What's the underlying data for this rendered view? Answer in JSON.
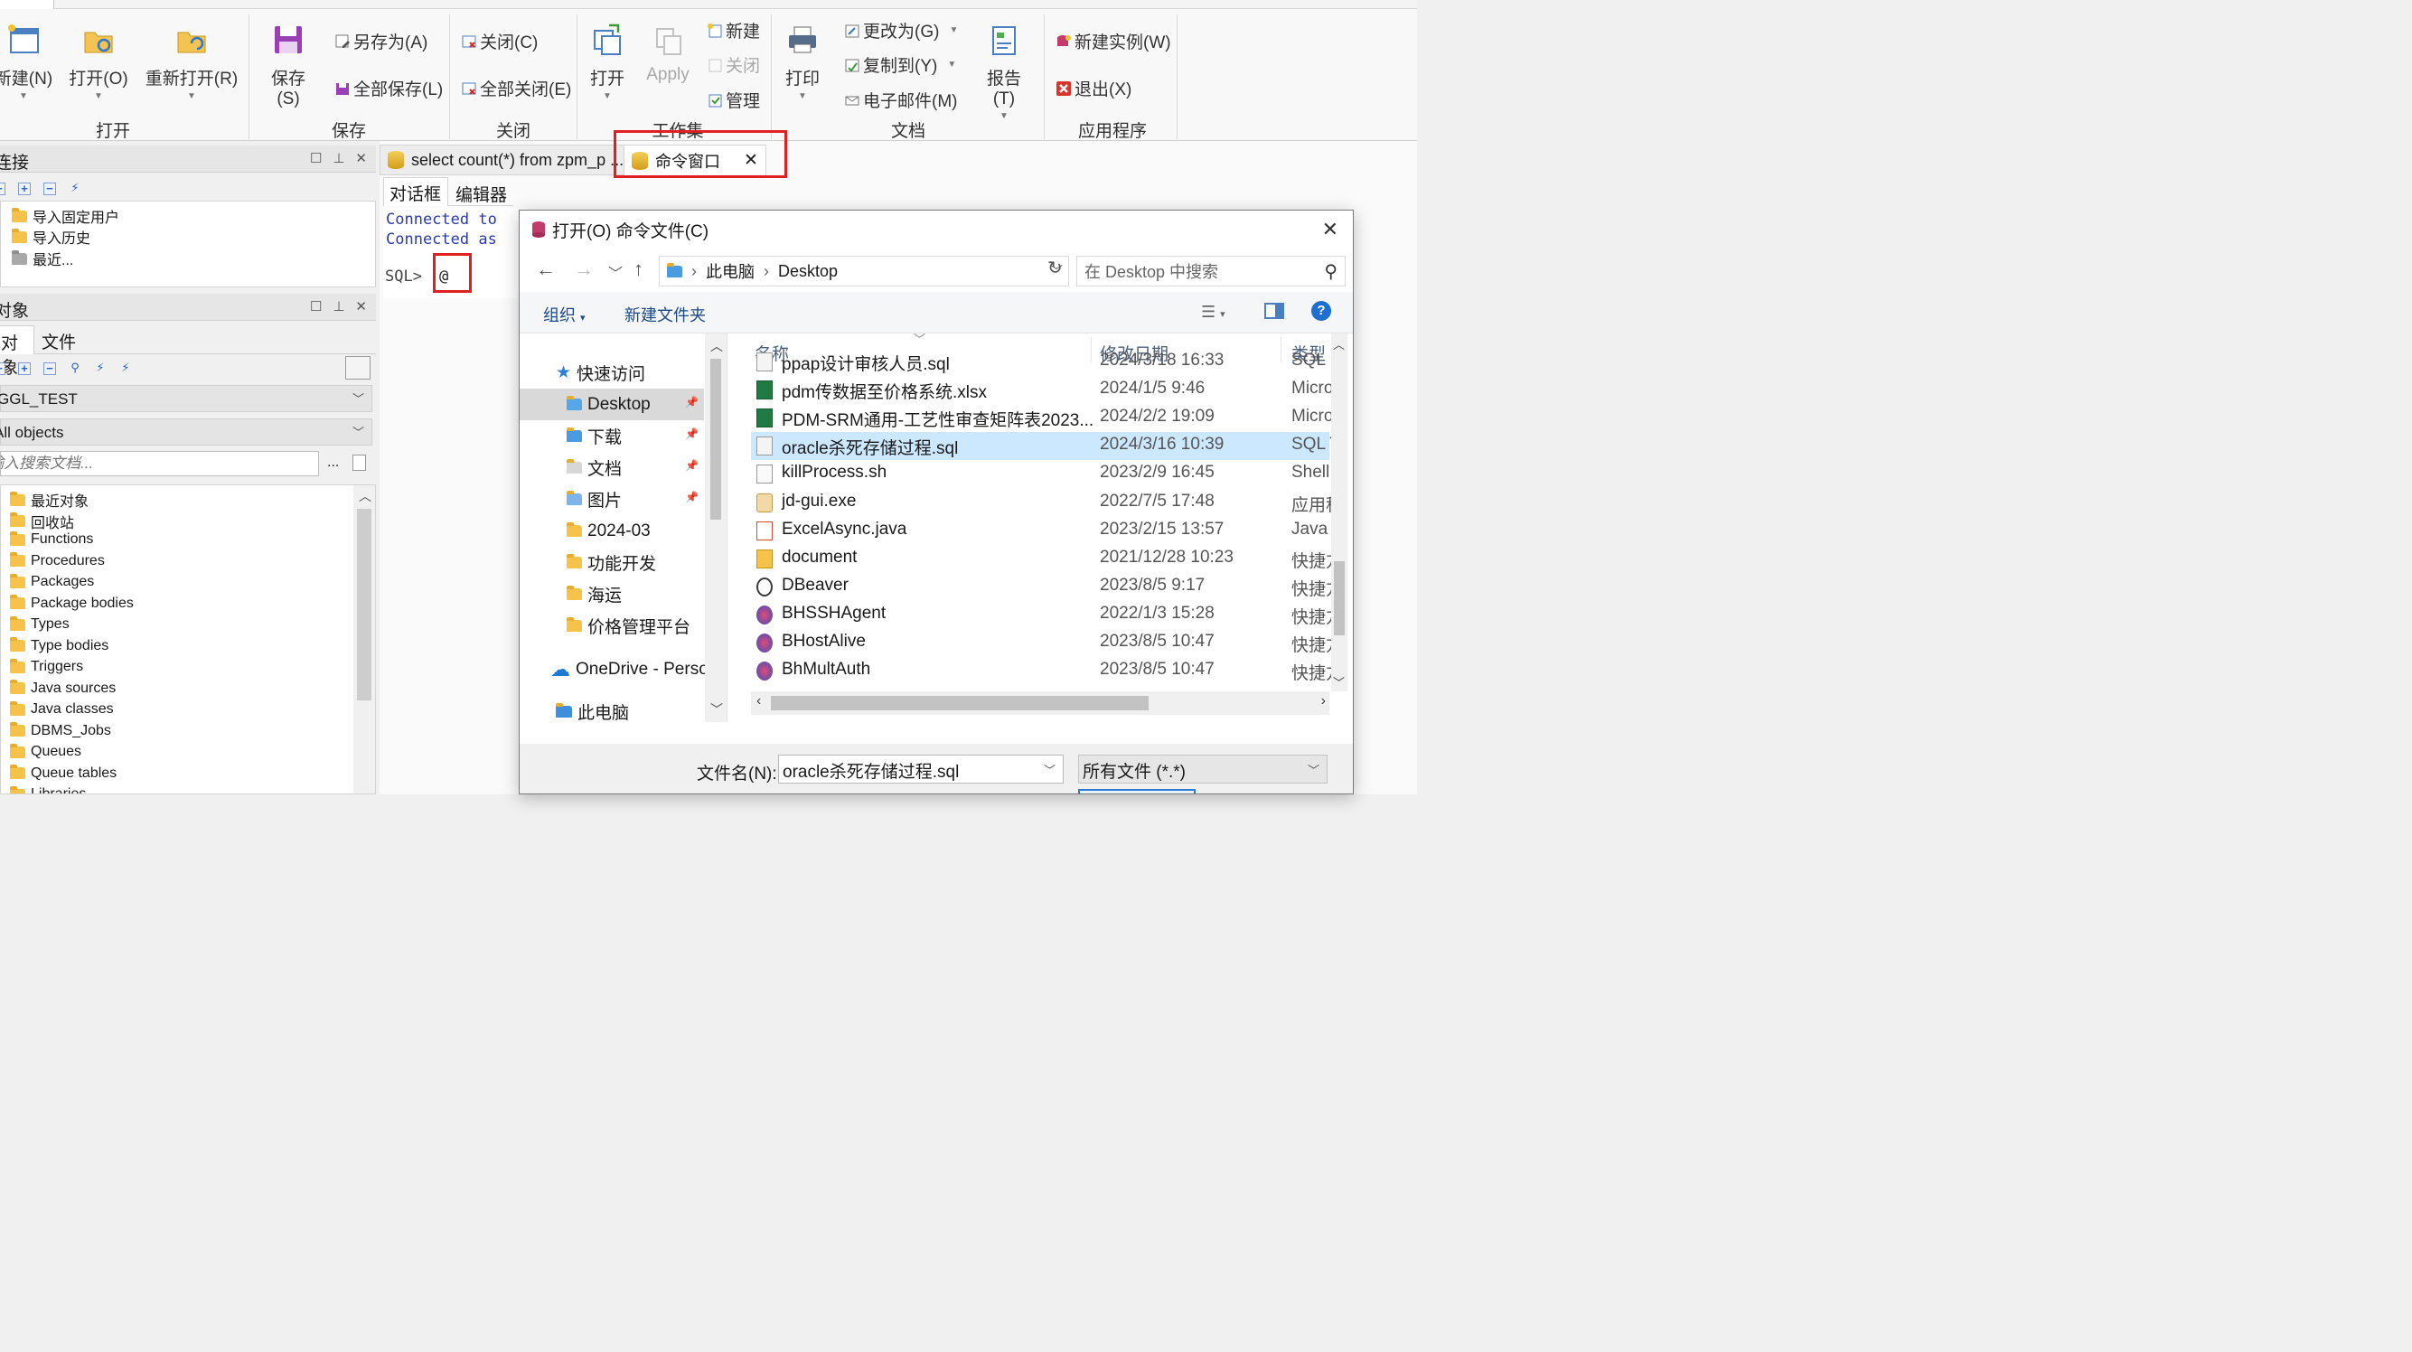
{
  "ribbon": {
    "groups": {
      "open": "打开",
      "save": "保存",
      "close": "关闭",
      "workset": "工作集",
      "document": "文档",
      "application": "应用程序"
    },
    "new_label": "新建(N)",
    "open_label": "打开(O)",
    "reopen_label": "重新打开(R)",
    "save_label": "保存(S)",
    "save_as_label": "另存为(A)",
    "save_all_label": "全部保存(L)",
    "close_label": "关闭(C)",
    "close_all_label": "全部关闭(E)",
    "ws_open_label": "打开",
    "ws_apply_label": "Apply",
    "ws_new_label": "新建",
    "ws_close_label": "关闭",
    "ws_manage_label": "管理",
    "print_label": "打印",
    "change_to_label": "更改为(G)",
    "copy_to_label": "复制到(Y)",
    "email_label": "电子邮件(M)",
    "report_label": "报告(T)",
    "new_instance_label": "新建实例(W)",
    "exit_label": "退出(X)"
  },
  "connection_panel": {
    "title": "连接",
    "items": [
      "导入固定用户",
      "导入历史",
      "最近..."
    ]
  },
  "object_panel": {
    "title": "对象",
    "tabs": [
      "对象",
      "文件"
    ],
    "schema": "GGL_TEST",
    "filter": "All objects",
    "search_placeholder": "输入搜索文档...",
    "tree": [
      "最近对象",
      "回收站",
      "Functions",
      "Procedures",
      "Packages",
      "Package bodies",
      "Types",
      "Type bodies",
      "Triggers",
      "Java sources",
      "Java classes",
      "DBMS_Jobs",
      "Queues",
      "Queue tables",
      "Libraries"
    ]
  },
  "editor": {
    "tabs": [
      "select count(*) from zpm_p ...",
      "命令窗口"
    ],
    "subtabs": [
      "对话框",
      "编辑器"
    ],
    "console_lines": [
      "Connected to",
      "Connected as"
    ],
    "prompt": "SQL>",
    "input": "@"
  },
  "dialog": {
    "title": "打开(O) 命令文件(C)",
    "breadcrumb": [
      "此电脑",
      "Desktop"
    ],
    "search_placeholder": "在 Desktop 中搜索",
    "organize_label": "组织",
    "new_folder_label": "新建文件夹",
    "nav_items": [
      {
        "label": "快速访问"
      },
      {
        "label": "Desktop"
      },
      {
        "label": "下载"
      },
      {
        "label": "文档"
      },
      {
        "label": "图片"
      },
      {
        "label": "2024-03"
      },
      {
        "label": "功能开发"
      },
      {
        "label": "海运"
      },
      {
        "label": "价格管理平台"
      },
      {
        "label": "OneDrive - Perso"
      },
      {
        "label": "此电脑"
      }
    ],
    "columns": {
      "name": "名称",
      "date": "修改日期",
      "type": "类型"
    },
    "files": [
      {
        "name": "ppap设计审核人员.sql",
        "date": "2024/3/18 16:33",
        "type": "SQL",
        "icon": "sql-file-icon"
      },
      {
        "name": "pdm传数据至价格系统.xlsx",
        "date": "2024/1/5 9:46",
        "type": "Micro",
        "icon": "excel-file-icon"
      },
      {
        "name": "PDM-SRM通用-工艺性审查矩阵表2023...",
        "date": "2024/2/2 19:09",
        "type": "Micro",
        "icon": "excel-file-icon"
      },
      {
        "name": "oracle杀死存储过程.sql",
        "date": "2024/3/16 10:39",
        "type": "SQL T",
        "icon": "sql-file-icon",
        "selected": true
      },
      {
        "name": "killProcess.sh",
        "date": "2023/2/9 16:45",
        "type": "Shell",
        "icon": "shell-file-icon"
      },
      {
        "name": "jd-gui.exe",
        "date": "2022/7/5 17:48",
        "type": "应用程",
        "icon": "exe-file-icon"
      },
      {
        "name": "ExcelAsync.java",
        "date": "2023/2/15 13:57",
        "type": "Java",
        "icon": "java-file-icon"
      },
      {
        "name": "document",
        "date": "2021/12/28 10:23",
        "type": "快捷方",
        "icon": "shortcut-folder-icon"
      },
      {
        "name": "DBeaver",
        "date": "2023/8/5 9:17",
        "type": "快捷方",
        "icon": "dbeaver-app-icon"
      },
      {
        "name": "BHSSHAgent",
        "date": "2022/1/3 15:28",
        "type": "快捷方",
        "icon": "bh-app-icon"
      },
      {
        "name": "BHostAlive",
        "date": "2023/8/5 10:47",
        "type": "快捷方",
        "icon": "bh-app-icon"
      },
      {
        "name": "BhMultAuth",
        "date": "2023/8/5 10:47",
        "type": "快捷方",
        "icon": "bh-app-icon"
      }
    ],
    "filename_label": "文件名(N):",
    "filename_value": "oracle杀死存储过程.sql",
    "filetype_value": "所有文件 (*.*)"
  },
  "colors": {
    "highlight_box": "#e02020",
    "selection": "#cce8ff",
    "console_text": "#2a3aa8",
    "folder": "#f5c24a",
    "help_blue": "#1f6fd1"
  }
}
